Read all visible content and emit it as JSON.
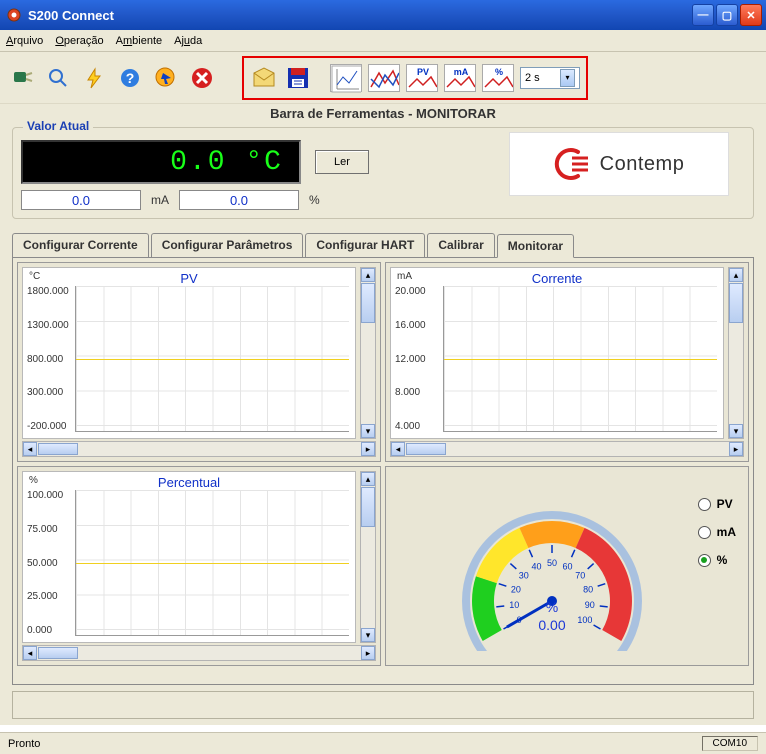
{
  "window": {
    "title": "S200 Connect"
  },
  "menu": {
    "items": [
      "Arquivo",
      "Operação",
      "Ambiente",
      "Ajuda"
    ]
  },
  "toolbar": {
    "caption": "Barra de Ferramentas - MONITORAR",
    "labels": {
      "pv": "PV",
      "ma": "mA",
      "pct": "%"
    },
    "refresh": "2  s"
  },
  "valor": {
    "legend": "Valor Atual",
    "lcd": "0.0  °C",
    "ler": "Ler",
    "ma_value": "0.0",
    "ma_unit": "mA",
    "pct_value": "0.0",
    "pct_unit": "%"
  },
  "brand": {
    "name": "Contemp"
  },
  "tabs": {
    "items": [
      "Configurar Corrente",
      "Configurar Parâmetros",
      "Configurar HART",
      "Calibrar",
      "Monitorar"
    ],
    "activeIndex": 4
  },
  "gauge": {
    "unit": "%",
    "value": "0.00",
    "radios": [
      "PV",
      "mA",
      "%"
    ],
    "selectedIndex": 2,
    "ticks": [
      "0",
      "10",
      "20",
      "30",
      "40",
      "50",
      "60",
      "70",
      "80",
      "90",
      "100"
    ]
  },
  "status": {
    "left": "Pronto",
    "right": "COM10"
  },
  "chart_data": [
    {
      "id": "pv",
      "type": "line",
      "title": "PV",
      "unit": "°C",
      "yticks": [
        -200.0,
        300.0,
        800.0,
        1300.0,
        1800.0
      ],
      "ylim": [
        -200.0,
        1800.0
      ],
      "xlabel": "",
      "ylabel": "°C",
      "reference_lines": [
        {
          "value": 800.0,
          "color": "#f0d020"
        }
      ],
      "series": [
        {
          "name": "PV",
          "x": [],
          "values": []
        }
      ]
    },
    {
      "id": "corrente",
      "type": "line",
      "title": "Corrente",
      "unit": "mA",
      "yticks": [
        4.0,
        8.0,
        12.0,
        16.0,
        20.0
      ],
      "ylim": [
        4.0,
        20.0
      ],
      "xlabel": "",
      "ylabel": "mA",
      "reference_lines": [
        {
          "value": 12.0,
          "color": "#f0d020"
        }
      ],
      "series": [
        {
          "name": "Corrente",
          "x": [],
          "values": []
        }
      ]
    },
    {
      "id": "percentual",
      "type": "line",
      "title": "Percentual",
      "unit": "%",
      "yticks": [
        0.0,
        25.0,
        50.0,
        75.0,
        100.0
      ],
      "ylim": [
        0.0,
        100.0
      ],
      "xlabel": "",
      "ylabel": "%",
      "reference_lines": [
        {
          "value": 50.0,
          "color": "#f0d020"
        }
      ],
      "series": [
        {
          "name": "Percentual",
          "x": [],
          "values": []
        }
      ]
    }
  ]
}
